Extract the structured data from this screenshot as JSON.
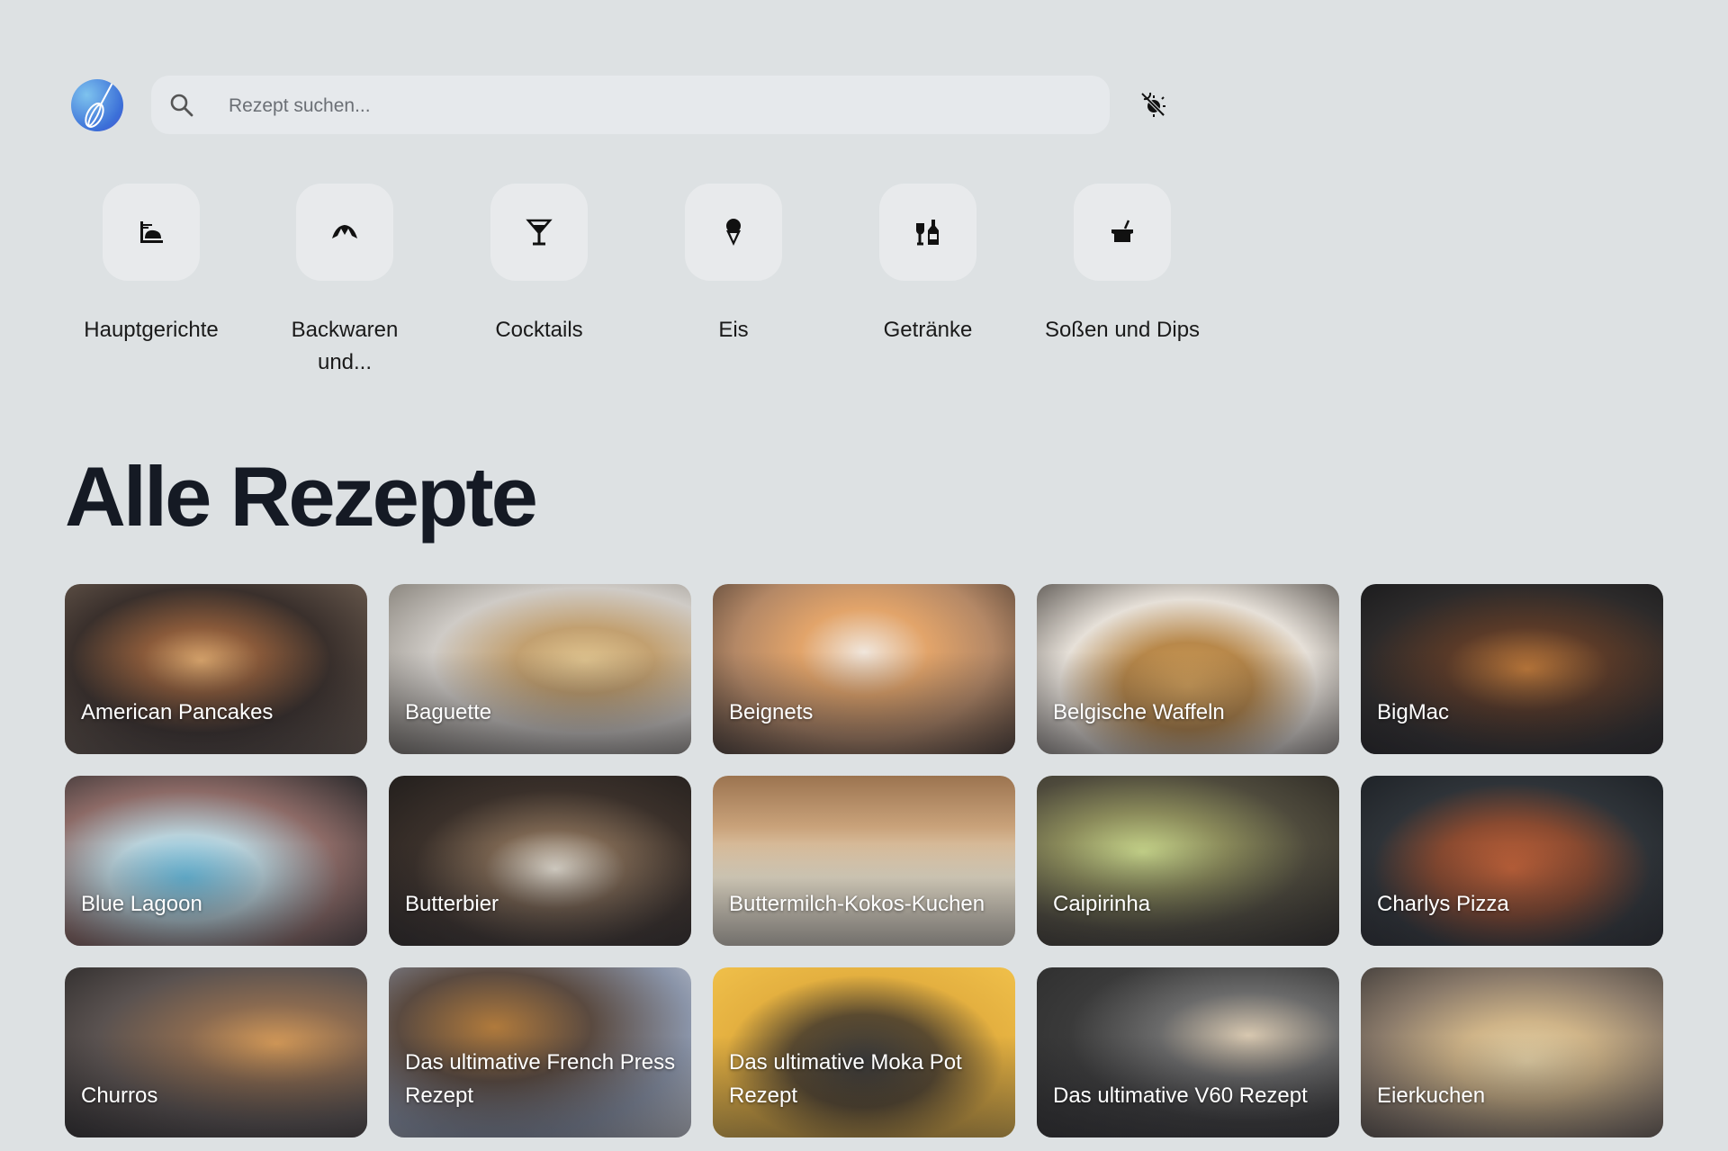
{
  "header": {
    "logo_icon": "whisk-logo-icon",
    "search_placeholder": "Rezept suchen...",
    "search_value": "",
    "theme_toggle_icon": "theme-toggle-icon"
  },
  "categories": [
    {
      "label": "Hauptgerichte",
      "icon": "main-dish-icon"
    },
    {
      "label": "Backwaren und...",
      "icon": "croissant-icon"
    },
    {
      "label": "Cocktails",
      "icon": "cocktail-glass-icon"
    },
    {
      "label": "Eis",
      "icon": "ice-cream-icon"
    },
    {
      "label": "Getränke",
      "icon": "drinks-bottle-icon"
    },
    {
      "label": "Soßen und Dips",
      "icon": "sauce-bowl-icon"
    }
  ],
  "section_title": "Alle Rezepte",
  "recipes": [
    {
      "title": "American Pancakes"
    },
    {
      "title": "Baguette"
    },
    {
      "title": "Beignets"
    },
    {
      "title": "Belgische Waffeln"
    },
    {
      "title": "BigMac"
    },
    {
      "title": "Blue Lagoon"
    },
    {
      "title": "Butterbier"
    },
    {
      "title": "Buttermilch-Kokos-Kuchen"
    },
    {
      "title": "Caipirinha"
    },
    {
      "title": "Charlys Pizza"
    },
    {
      "title": "Churros"
    },
    {
      "title": "Das ultimative French Press Rezept"
    },
    {
      "title": "Das ultimative Moka Pot Rezept"
    },
    {
      "title": "Das ultimative V60 Rezept"
    },
    {
      "title": "Eierkuchen"
    }
  ]
}
